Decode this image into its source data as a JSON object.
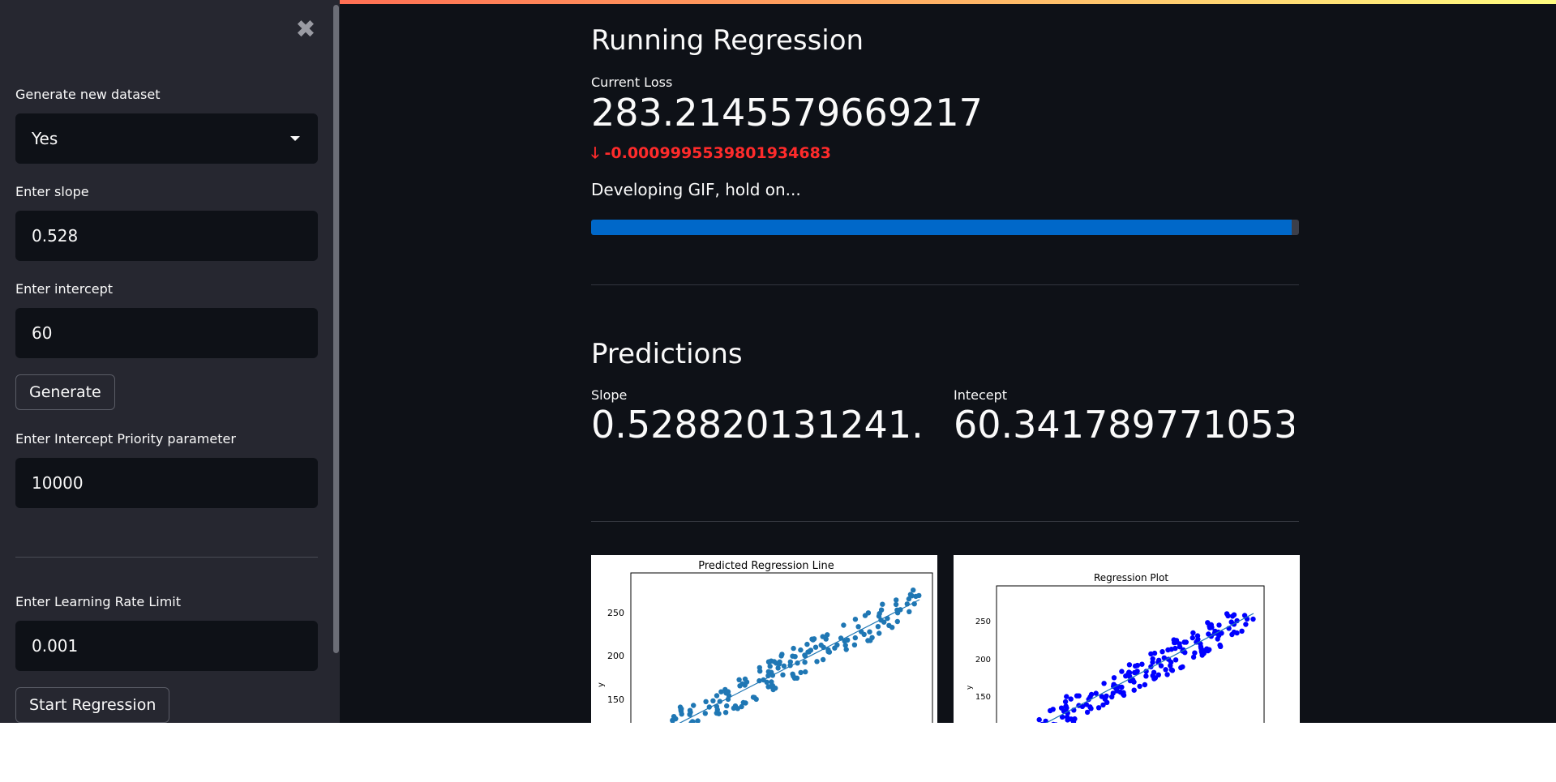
{
  "sidebar": {
    "dataset_label": "Generate new dataset",
    "dataset_value": "Yes",
    "slope_label": "Enter slope",
    "slope_value": "0.528",
    "intercept_label": "Enter intercept",
    "intercept_value": "60",
    "generate_label": "Generate",
    "priority_label": "Enter Intercept Priority parameter",
    "priority_value": "10000",
    "lr_label": "Enter Learning Rate Limit",
    "lr_value": "0.001",
    "start_label": "Start Regression",
    "close_glyph": "✖"
  },
  "main": {
    "running_title": "Running Regression",
    "loss_label": "Current Loss",
    "loss_value": "283.2145579669217",
    "loss_delta": "-0.0009995539801934683",
    "delta_arrow": "🡓",
    "status_text": "Developing GIF, hold on...",
    "progress": 0.99,
    "predictions_title": "Predictions",
    "slope_label": "Slope",
    "slope_value": "0.528820131241...",
    "intercept_label": "Intecept",
    "intercept_value": "60.341789771053..."
  },
  "plots": {
    "left_title": "Predicted Regression Line",
    "right_title": "Regression Plot",
    "ylabel": "y",
    "ticks": [
      "250",
      "200",
      "150"
    ],
    "left_color": "#1f77b4",
    "right_color": "#0000ff"
  },
  "colors": {
    "background": "#0e1117",
    "sidebar": "#262730",
    "progress": "#0068c9",
    "delta_negative": "#ff2b2b"
  }
}
